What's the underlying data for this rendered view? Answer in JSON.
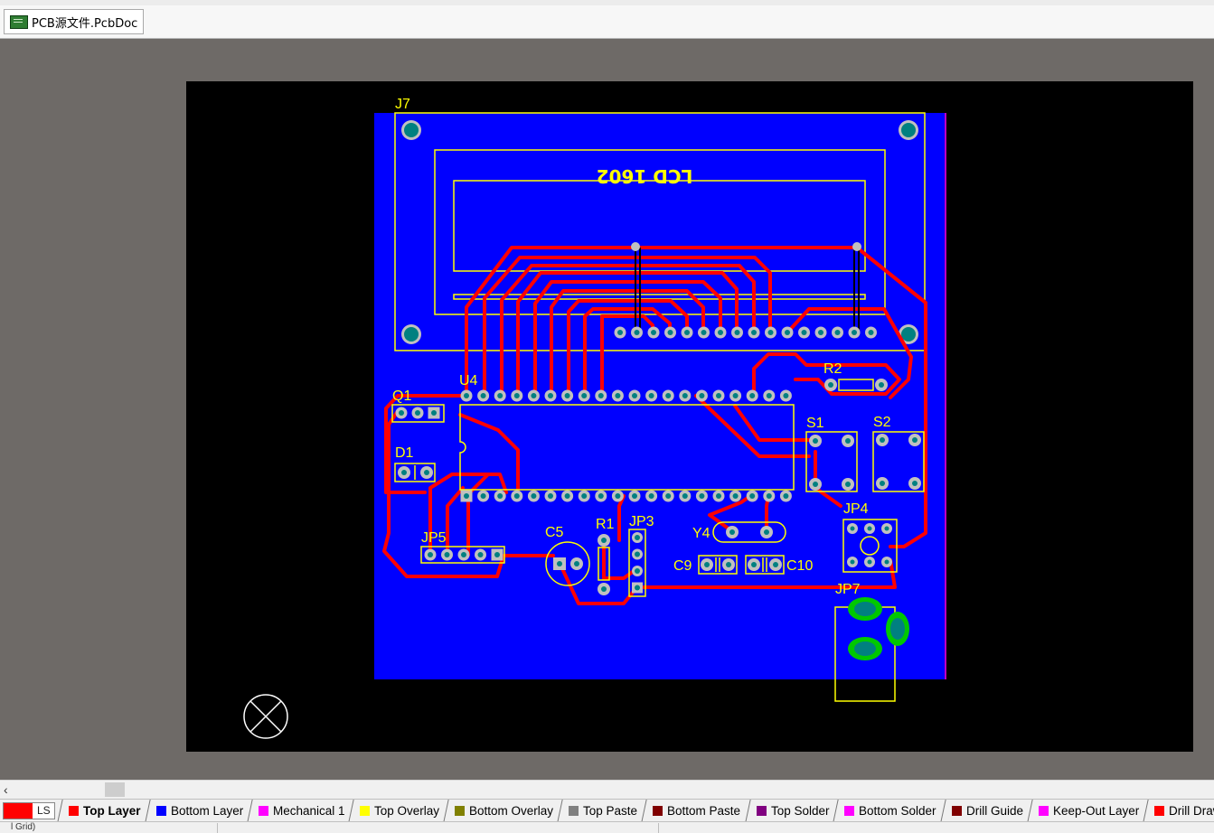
{
  "document_tab": {
    "title": "PCB源文件.PcbDoc",
    "icon": "pcb-document-icon"
  },
  "layer_set_label": "LS",
  "layers": [
    {
      "label": "Top Layer",
      "color": "#ff0000",
      "active": true
    },
    {
      "label": "Bottom Layer",
      "color": "#0000ff"
    },
    {
      "label": "Mechanical 1",
      "color": "#ff00ff"
    },
    {
      "label": "Top Overlay",
      "color": "#ffff00"
    },
    {
      "label": "Bottom Overlay",
      "color": "#808000"
    },
    {
      "label": "Top Paste",
      "color": "#808080"
    },
    {
      "label": "Bottom Paste",
      "color": "#800000"
    },
    {
      "label": "Top Solder",
      "color": "#800080"
    },
    {
      "label": "Bottom Solder",
      "color": "#ff00ff"
    },
    {
      "label": "Drill Guide",
      "color": "#800000"
    },
    {
      "label": "Keep-Out Layer",
      "color": "#ff00ff"
    },
    {
      "label": "Drill Drawing",
      "color": "#ff0000"
    }
  ],
  "status": {
    "text": "l Grid)"
  },
  "board": {
    "silkscreen_title": "LCD 1602",
    "designators": [
      "J7",
      "U4",
      "Q1",
      "D1",
      "JP5",
      "C5",
      "R1",
      "JP3",
      "Y4",
      "C9",
      "C10",
      "R2",
      "S1",
      "S2",
      "JP4",
      "JP7"
    ]
  },
  "colors": {
    "workspace": "#6e6a67",
    "board_background": "#000000",
    "bottom_copper": "#0000ff",
    "top_copper": "#ff0000",
    "overlay": "#ffff00",
    "pad": "#c0c0c0",
    "via_hole": "#008080",
    "jp7_pad": "#00c800"
  }
}
